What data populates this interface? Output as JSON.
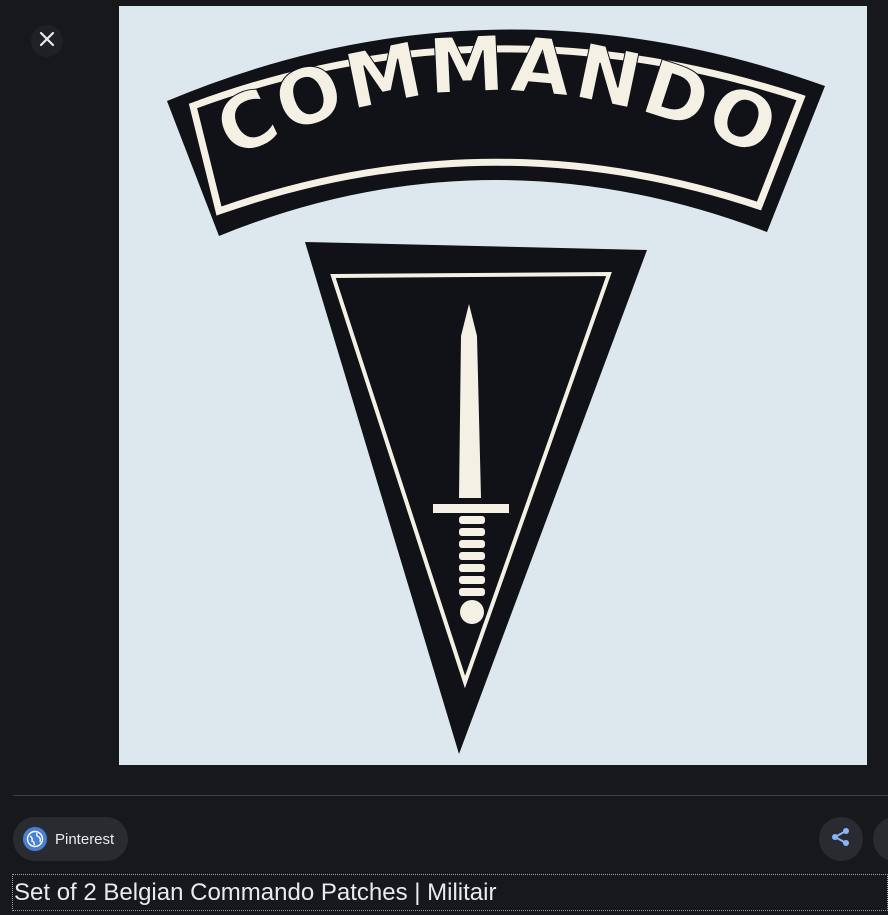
{
  "viewer": {
    "close_icon": "close-icon",
    "image": {
      "patch_text": "COMMANDO",
      "background_color": "#dde8ee",
      "patch_color": "#101218",
      "stitch_color": "#f4f1e4"
    },
    "source": {
      "label": "Pinterest",
      "icon": "globe-icon",
      "icon_color": "#4a7fd8"
    },
    "actions": {
      "share_icon": "share-icon",
      "share_icon_color": "#8ab4f8"
    },
    "title": "Set of 2 Belgian Commando Patches | Militair"
  }
}
